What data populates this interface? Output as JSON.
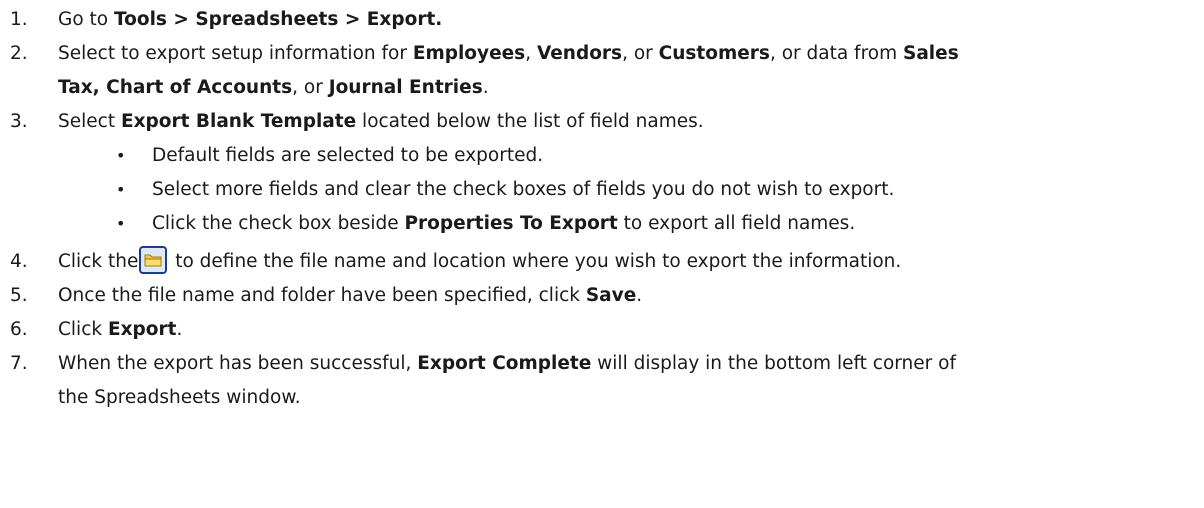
{
  "steps": [
    {
      "number": "1.",
      "segments": [
        "Go to ",
        "Tools > Spreadsheets > Export."
      ]
    },
    {
      "number": "2.",
      "line1": [
        "Select to export setup information for ",
        "Employees",
        ", ",
        "Vendors",
        ", or ",
        "Customers",
        ", or data from ",
        "Sales"
      ],
      "line2": [
        "Tax, Chart of Accounts",
        ", or ",
        "Journal Entries",
        "."
      ]
    },
    {
      "number": "3.",
      "segments": [
        "Select ",
        "Export Blank Template",
        " located below the list of field names."
      ],
      "bullets": [
        {
          "marker": "•",
          "text": "Default fields are selected to be exported."
        },
        {
          "marker": "•",
          "text": "Select more fields and clear the check boxes of fields you do not wish to export."
        },
        {
          "marker": "•",
          "segments": [
            "Click the check box beside ",
            "Properties To Export",
            " to export all field names."
          ]
        }
      ]
    },
    {
      "number": "4.",
      "before_icon": "Click the",
      "icon": "folder-icon",
      "after_icon": " to define the file name and location where you wish to export the information."
    },
    {
      "number": "5.",
      "segments": [
        "Once the file name and folder have been specified, click ",
        "Save",
        "."
      ]
    },
    {
      "number": "6.",
      "segments": [
        "Click ",
        "Export",
        "."
      ]
    },
    {
      "number": "7.",
      "line1": [
        "When the export has been successful, ",
        "Export Complete",
        " will display in the bottom left corner of"
      ],
      "line2": [
        "the Spreadsheets window."
      ]
    }
  ],
  "colors": {
    "text": "#1a1a1a",
    "icon_border": "#1f3c88",
    "icon_folder": "#f5c842"
  }
}
